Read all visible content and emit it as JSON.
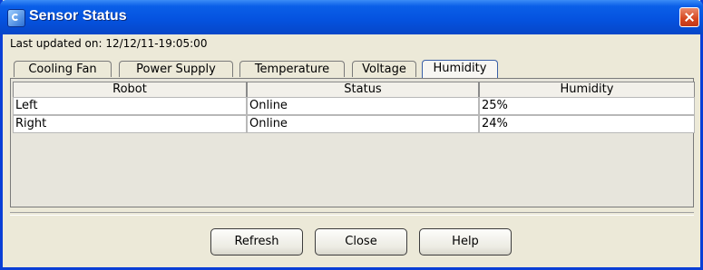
{
  "window": {
    "title": "Sensor Status"
  },
  "status": {
    "last_updated": "Last updated on: 12/12/11-19:05:00"
  },
  "tabs": [
    {
      "label": "Cooling Fan",
      "active": false
    },
    {
      "label": "Power Supply",
      "active": false
    },
    {
      "label": "Temperature",
      "active": false
    },
    {
      "label": "Voltage",
      "active": false
    },
    {
      "label": "Humidity",
      "active": true
    }
  ],
  "table": {
    "headers": [
      "Robot",
      "Status",
      "Humidity"
    ],
    "rows": [
      [
        "Left",
        "Online",
        "25%"
      ],
      [
        "Right",
        "Online",
        "24%"
      ]
    ]
  },
  "buttons": {
    "refresh": "Refresh",
    "close": "Close",
    "help": "Help"
  },
  "colors": {
    "titlebar": "#0553e0",
    "close": "#d6461e",
    "dialog_bg": "#ece9d8"
  }
}
